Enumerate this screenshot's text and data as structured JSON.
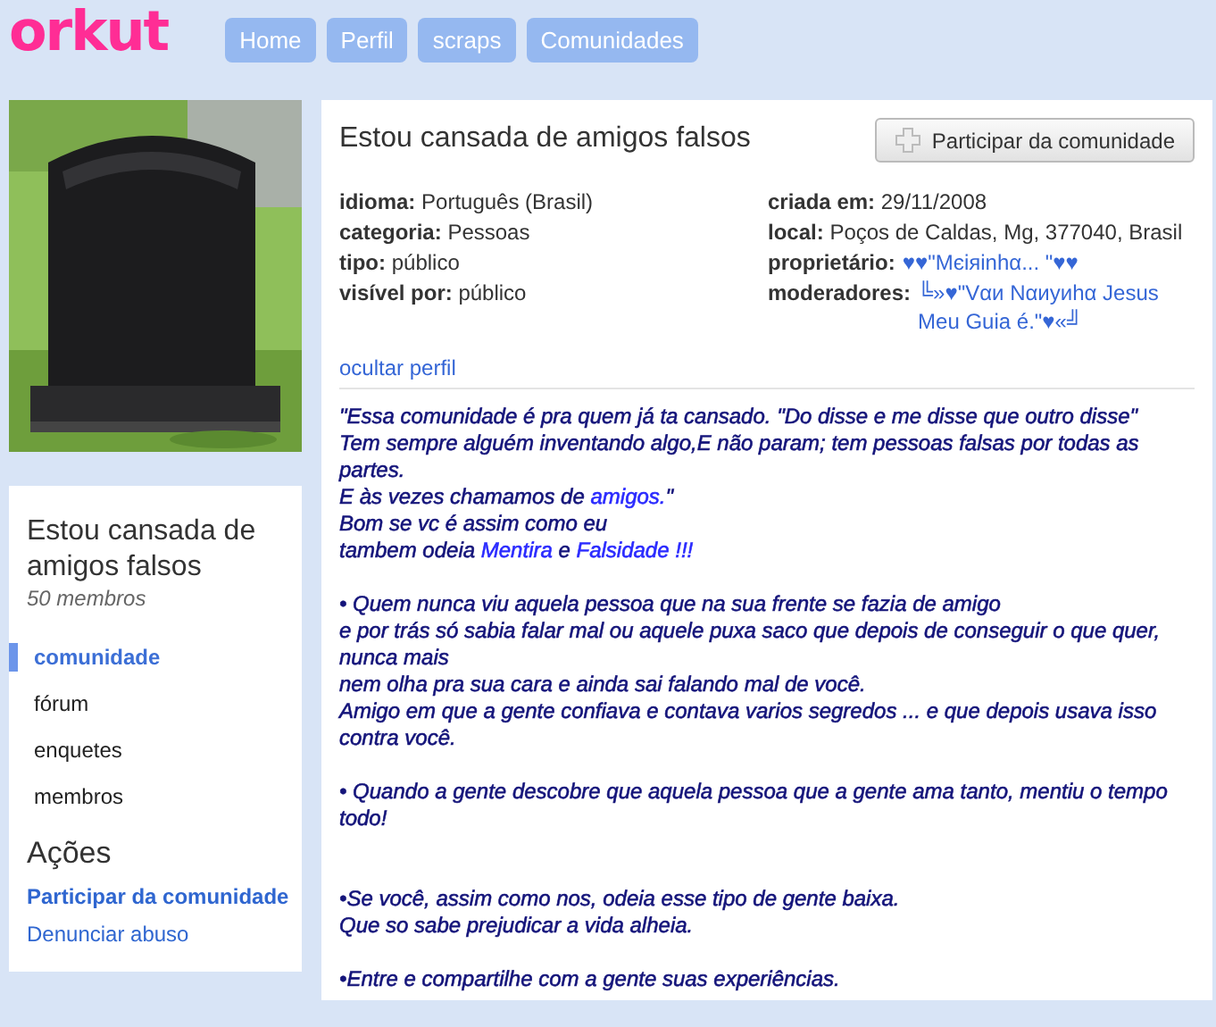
{
  "logo": "orkut",
  "nav": [
    {
      "label": "Home"
    },
    {
      "label": "Perfil"
    },
    {
      "label": "scraps"
    },
    {
      "label": "Comunidades"
    }
  ],
  "community": {
    "name": "Estou cansada de amigos falsos",
    "members": "50 membros"
  },
  "menu": [
    {
      "label": "comunidade",
      "selected": true
    },
    {
      "label": "fórum",
      "selected": false
    },
    {
      "label": "enquetes",
      "selected": false
    },
    {
      "label": "membros",
      "selected": false
    }
  ],
  "actions": {
    "title": "Ações",
    "items": [
      {
        "label": "Participar da comunidade",
        "kind": "primary"
      },
      {
        "label": "Denunciar abuso",
        "kind": "link"
      }
    ]
  },
  "main": {
    "title": "Estou cansada de amigos falsos",
    "join_button": "Participar da comunidade",
    "info_left": [
      {
        "label": "idioma:",
        "value": "Português (Brasil)",
        "kind": "text"
      },
      {
        "label": "categoria:",
        "value": "Pessoas",
        "kind": "text"
      },
      {
        "label": "tipo:",
        "value": "público",
        "kind": "text"
      },
      {
        "label": "visível por:",
        "value": "público",
        "kind": "text"
      }
    ],
    "info_right": [
      {
        "label": "criada em:",
        "value": "29/11/2008",
        "kind": "text"
      },
      {
        "label": "local:",
        "value": "Poços de Caldas, Mg, 377040, Brasil",
        "kind": "text"
      },
      {
        "label": "proprietário:",
        "value": "♥♥\"Мєiяinhα... \"♥♥",
        "kind": "link"
      },
      {
        "label": "moderadores:",
        "value": "╚»♥\"Vαи Nαиyиhα Jesus Meu Guia é.\"♥«╝",
        "kind": "link"
      }
    ],
    "hide_profile": "ocultar perfil",
    "description": [
      {
        "lines": [
          [
            {
              "text": "\"Essa comunidade é pra quem já ta cansado. \"Do disse e me disse que outro disse\"",
              "highlight": false
            }
          ],
          [
            {
              "text": "Tem sempre alguém inventando algo,E não param; tem pessoas falsas por todas as partes.",
              "highlight": false
            }
          ],
          [
            {
              "text": "E às vezes chamamos de ",
              "highlight": false
            },
            {
              "text": "amigos.",
              "highlight": true
            },
            {
              "text": "\"",
              "highlight": false
            }
          ],
          [
            {
              "text": "Bom se vc é assim como eu",
              "highlight": false
            }
          ],
          [
            {
              "text": "tambem odeia ",
              "highlight": false
            },
            {
              "text": "Mentira",
              "highlight": true
            },
            {
              "text": " e ",
              "highlight": false
            },
            {
              "text": "Falsidade !!!",
              "highlight": true
            }
          ]
        ]
      },
      {
        "lines": [
          [
            {
              "text": "• Quem nunca viu aquela pessoa que na sua frente se fazia de amigo",
              "highlight": false
            }
          ],
          [
            {
              "text": "e por trás só sabia falar mal ou aquele puxa saco que depois de conseguir o que quer, nunca mais",
              "highlight": false
            }
          ],
          [
            {
              "text": "nem olha pra sua cara e ainda sai falando mal de você.",
              "highlight": false
            }
          ],
          [
            {
              "text": "Amigo em que a gente confiava e contava varios segredos ... e que depois usava isso contra você.",
              "highlight": false
            }
          ]
        ]
      },
      {
        "lines": [
          [
            {
              "text": "• Quando a gente descobre que aquela pessoa que a gente ama tanto, mentiu o tempo todo!",
              "highlight": false
            }
          ]
        ]
      },
      {
        "lines": [
          [
            {
              "text": "•Se você, assim como nos, odeia esse tipo de gente baixa.",
              "highlight": false
            }
          ],
          [
            {
              "text": "Que so sabe prejudicar a vida alheia.",
              "highlight": false
            }
          ]
        ]
      },
      {
        "lines": [
          [
            {
              "text": "•Entre e compartilhe com a gente suas experiências.",
              "highlight": false
            }
          ]
        ]
      }
    ]
  }
}
